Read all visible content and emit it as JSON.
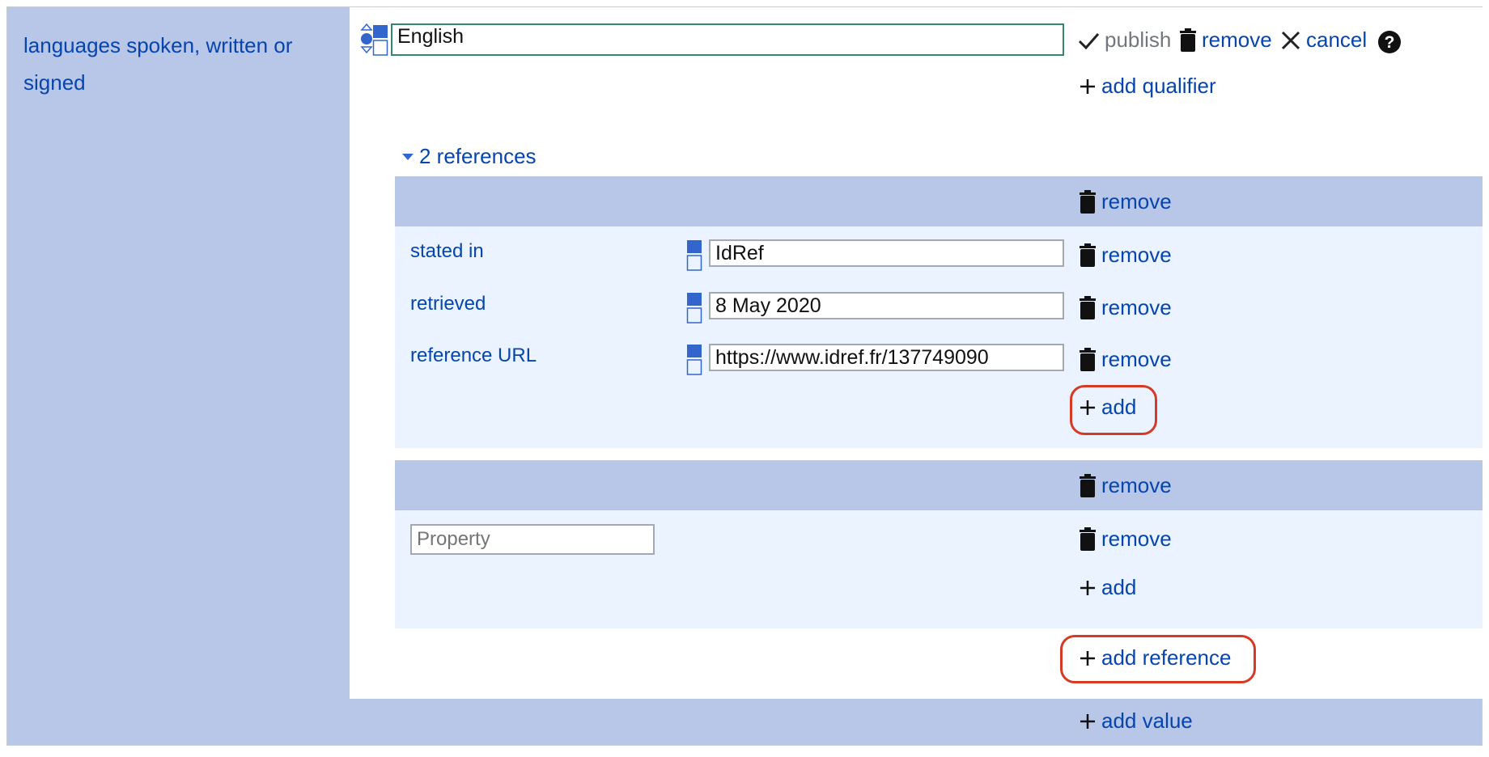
{
  "property": {
    "label": "languages spoken, written or signed"
  },
  "statement": {
    "value": "English",
    "toolbar": {
      "publish": "publish",
      "remove": "remove",
      "cancel": "cancel",
      "help_icon": "question-circle-icon"
    },
    "add_qualifier": "add qualifier"
  },
  "references": {
    "toggle": "2 references",
    "items": [
      {
        "remove": "remove",
        "snaks": [
          {
            "property": "stated in",
            "value": "IdRef",
            "remove": "remove"
          },
          {
            "property": "retrieved",
            "value": "8 May 2020",
            "remove": "remove"
          },
          {
            "property": "reference URL",
            "value": "https://www.idref.fr/137749090",
            "remove": "remove"
          }
        ],
        "add": "add"
      },
      {
        "remove": "remove",
        "snaks": [
          {
            "property_placeholder": "Property",
            "remove": "remove"
          }
        ],
        "add": "add"
      }
    ],
    "add_reference": "add reference"
  },
  "add_value": "add value",
  "colors": {
    "link": "#0645ad",
    "section_bg": "#b8c7e8",
    "reference_bg": "#eaf3ff",
    "highlight": "#d63a24",
    "input_focus_border": "#36866a"
  }
}
